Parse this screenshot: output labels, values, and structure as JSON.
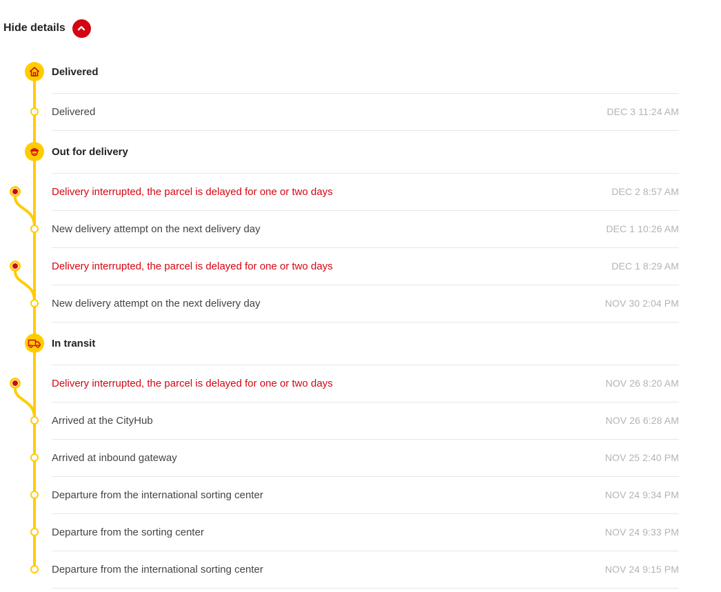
{
  "header": {
    "toggle_label": "Hide details",
    "toggle_icon": "chevron-up-icon"
  },
  "colors": {
    "accent": "#ffcc00",
    "error": "#d40511",
    "time": "#b3b3b3"
  },
  "stages": [
    {
      "title": "Delivered",
      "icon": "house-icon",
      "events": [
        {
          "text": "Delivered",
          "time": "DEC 3 11:24 AM",
          "error": false
        }
      ]
    },
    {
      "title": "Out for delivery",
      "icon": "courier-icon",
      "events": [
        {
          "text": "Delivery interrupted, the parcel is delayed for one or two days",
          "time": "DEC 2 8:57 AM",
          "error": true
        },
        {
          "text": "New delivery attempt on the next delivery day",
          "time": "DEC 1 10:26 AM",
          "error": false
        },
        {
          "text": "Delivery interrupted, the parcel is delayed for one or two days",
          "time": "DEC 1 8:29 AM",
          "error": true
        },
        {
          "text": "New delivery attempt on the next delivery day",
          "time": "NOV 30 2:04 PM",
          "error": false
        }
      ]
    },
    {
      "title": "In transit",
      "icon": "truck-icon",
      "events": [
        {
          "text": "Delivery interrupted, the parcel is delayed for one or two days",
          "time": "NOV 26 8:20 AM",
          "error": true
        },
        {
          "text": "Arrived at the CityHub",
          "time": "NOV 26 6:28 AM",
          "error": false
        },
        {
          "text": "Arrived at inbound gateway",
          "time": "NOV 25 2:40 PM",
          "error": false
        },
        {
          "text": "Departure from the international sorting center",
          "time": "NOV 24 9:34 PM",
          "error": false
        },
        {
          "text": "Departure from the sorting center",
          "time": "NOV 24 9:33 PM",
          "error": false
        },
        {
          "text": "Departure from the international sorting center",
          "time": "NOV 24 9:15 PM",
          "error": false
        }
      ]
    }
  ]
}
